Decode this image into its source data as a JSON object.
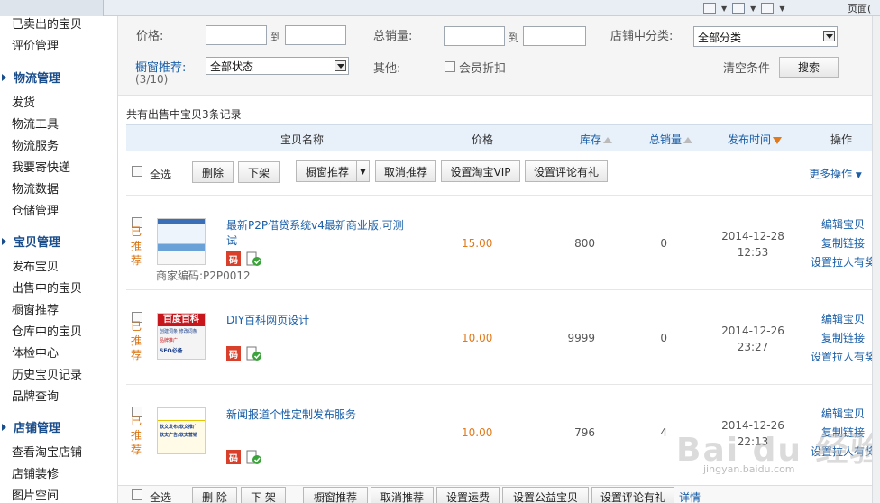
{
  "topbar": {
    "text": "页面("
  },
  "sidebar": {
    "top_partial": "已卖出的宝贝",
    "items_a": [
      "评价管理"
    ],
    "group_logistics": "物流管理",
    "logistics": [
      "发货",
      "物流工具",
      "物流服务",
      "我要寄快递",
      "物流数据",
      "仓储管理"
    ],
    "group_items": "宝贝管理",
    "items_mgmt": [
      "发布宝贝",
      "出售中的宝贝",
      "橱窗推荐",
      "仓库中的宝贝",
      "体检中心",
      "历史宝贝记录",
      "品牌查询"
    ],
    "group_shop": "店铺管理",
    "shop": [
      "查看淘宝店铺",
      "店铺装修",
      "图片空间"
    ]
  },
  "filter": {
    "price_label": "价格:",
    "to1": "到",
    "sales_label": "总销量:",
    "to2": "到",
    "category_label": "店铺中分类:",
    "category_value": "全部分类",
    "window_label": "橱窗推荐:",
    "window_count": "(3/10)",
    "status_value": "全部状态",
    "other_label": "其他:",
    "member_discount": "会员折扣",
    "clear": "清空条件",
    "search_btn": "搜索"
  },
  "record_count": "共有出售中宝贝3条记录",
  "table_header": {
    "name": "宝贝名称",
    "price": "价格",
    "stock": "库存",
    "sales": "总销量",
    "time": "发布时间",
    "ops": "操作"
  },
  "actions": {
    "select_all": "全选",
    "delete": "删除",
    "off_shelf": "下架",
    "window_rec": "橱窗推荐",
    "cancel_rec": "取消推荐",
    "set_vip": "设置淘宝VIP",
    "set_review_gift": "设置评论有礼",
    "more": "更多操作"
  },
  "rows": [
    {
      "rec": "已推荐",
      "title": "最新P2P借贷系统v4最新商业版,可测试",
      "code_icon": "码",
      "sku": "商家编码:P2P0012",
      "price": "15.00",
      "stock": "800",
      "sold": "0",
      "date": "2014-12-28",
      "time": "12:53",
      "op_edit": "编辑宝贝",
      "op_copy": "复制链接",
      "op_promo": "设置拉人有奖"
    },
    {
      "rec": "已推荐",
      "title": "DIY百科网页设计",
      "code_icon": "码",
      "sku": "",
      "price": "10.00",
      "stock": "9999",
      "sold": "0",
      "date": "2014-12-26",
      "time": "23:27",
      "op_edit": "编辑宝贝",
      "op_copy": "复制链接",
      "op_promo": "设置拉人有奖"
    },
    {
      "rec": "已推荐",
      "title": "新闻报道个性定制发布服务",
      "code_icon": "码",
      "sku": "",
      "price": "10.00",
      "stock": "796",
      "sold": "4",
      "date": "2014-12-26",
      "time": "22:13",
      "op_edit": "编辑宝贝",
      "op_copy": "复制链接",
      "op_promo": "设置拉人有奖"
    }
  ],
  "thumb2_text": [
    "百度百科",
    "创建词条",
    "修改词条",
    "品牌推广",
    "SEO必备"
  ],
  "thumb3_text": [
    "软文发布/软文推广",
    "软文广告/软文营销"
  ],
  "bottombar": {
    "select_all": "全选",
    "delete": "删 除",
    "off_shelf": "下 架",
    "window_rec": "橱窗推荐",
    "cancel_rec": "取消推荐",
    "set_shipping": "设置运费",
    "set_charity": "设置公益宝贝",
    "set_review_gift": "设置评论有礼",
    "details": "详情"
  },
  "watermark": {
    "logo": "Bai du 经验",
    "url": "jingyan.baidu.com"
  },
  "colors": {
    "link": "#1a5fa8",
    "orange": "#e07a1a",
    "header_bg": "#e8f0f9"
  }
}
